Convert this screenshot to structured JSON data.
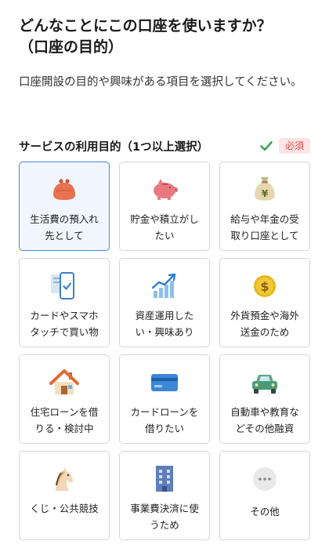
{
  "header": {
    "title": "どんなことにこの口座を使いますか？\n（口座の目的）",
    "description": "口座開設の目的や興味がある項目を選択してください。"
  },
  "section": {
    "title": "サービスの利用目的（1つ以上選択）",
    "required_label": "必須",
    "check_color": "#3aa655"
  },
  "options": [
    {
      "label": "生活費の預入れ\n先として",
      "icon": "coin-purse-icon",
      "selected": true
    },
    {
      "label": "貯金や積立がし\nたい",
      "icon": "piggy-bank-icon",
      "selected": false
    },
    {
      "label": "給与や年金の受\n取り口座として",
      "icon": "money-bag-icon",
      "selected": false
    },
    {
      "label": "カードやスマホ\nタッチで買い物",
      "icon": "smartphone-payment-icon",
      "selected": false
    },
    {
      "label": "資産運用した\nい・興味あり",
      "icon": "chart-growth-icon",
      "selected": false
    },
    {
      "label": "外貨預金や海外\n送金のため",
      "icon": "dollar-coin-icon",
      "selected": false
    },
    {
      "label": "住宅ローンを借\nりる・検討中",
      "icon": "house-icon",
      "selected": false
    },
    {
      "label": "カードローンを\n借りたい",
      "icon": "credit-card-icon",
      "selected": false
    },
    {
      "label": "自動車や教育な\nどその他融資",
      "icon": "car-icon",
      "selected": false
    },
    {
      "label": "くじ・公共競技",
      "icon": "horse-icon",
      "selected": false
    },
    {
      "label": "事業費決済に使\nうため",
      "icon": "building-icon",
      "selected": false
    },
    {
      "label": "その他",
      "icon": "more-icon",
      "selected": false
    }
  ],
  "colors": {
    "selected_border": "#4a86d8",
    "selected_bg": "#f1f6fd",
    "badge_bg": "#fde3e3",
    "badge_text": "#d9534f"
  }
}
